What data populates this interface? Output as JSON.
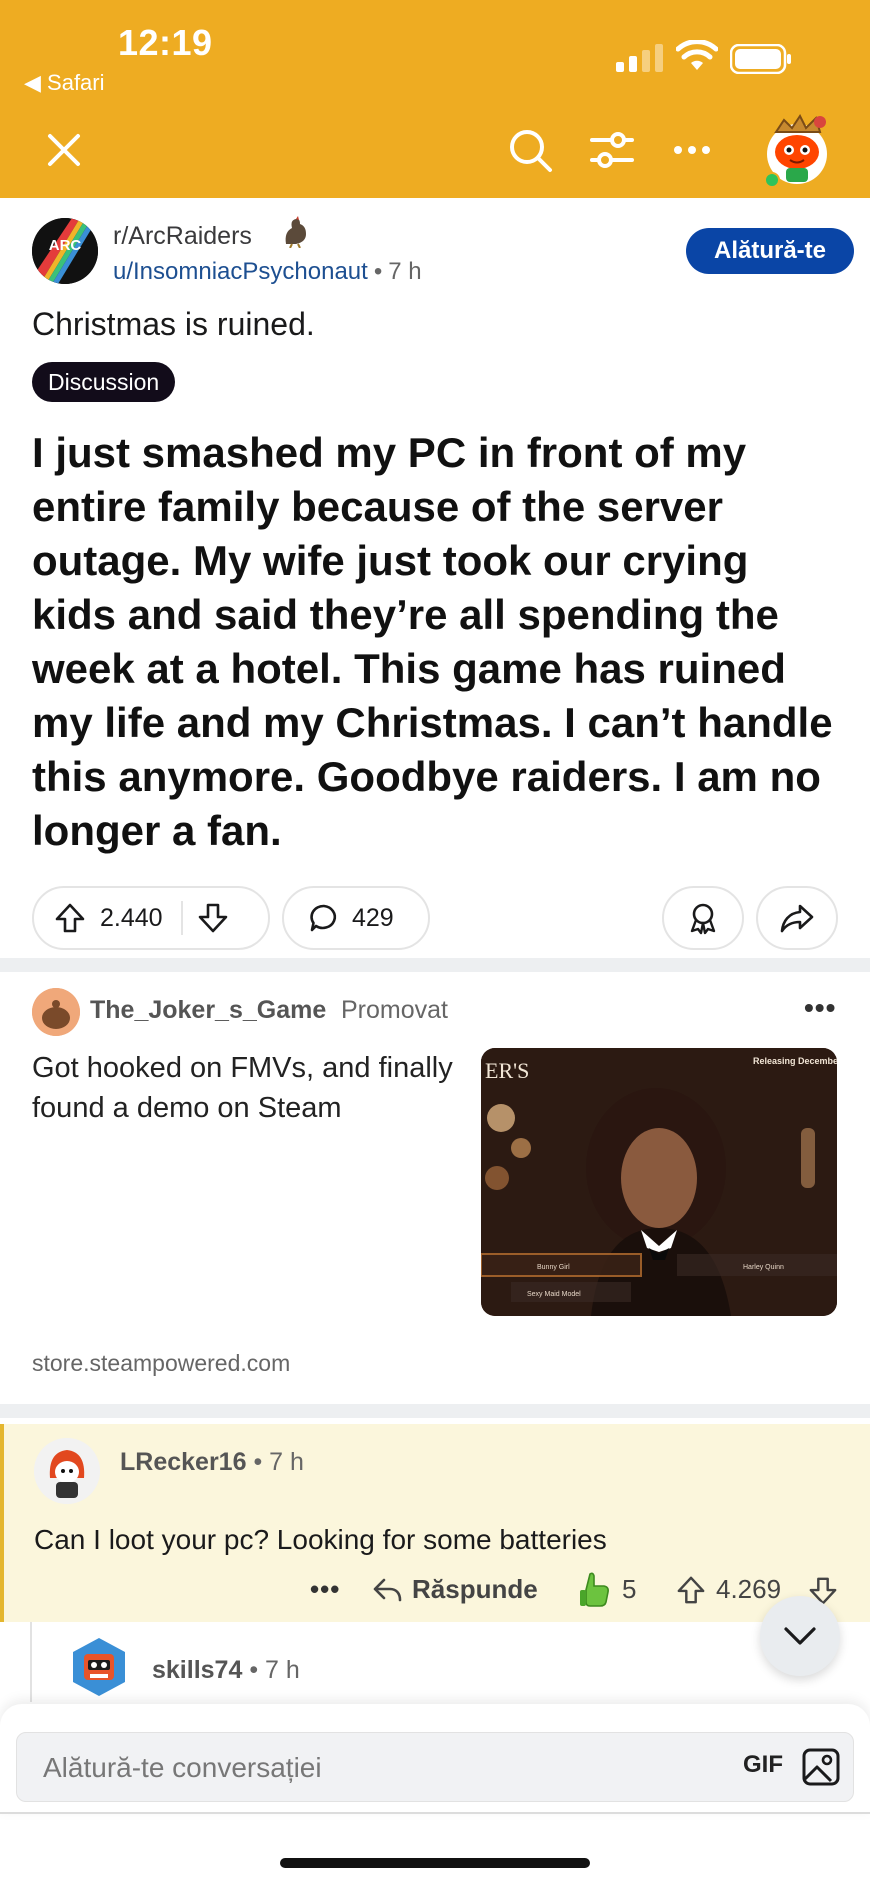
{
  "status_bar": {
    "time": "12:19",
    "back_app": "◀ Safari"
  },
  "post": {
    "subreddit": "r/ArcRaiders",
    "subreddit_logo_text": "ARC Raiders",
    "author": "u/InsomniacPsychonaut",
    "separator": "•",
    "time_ago": "7 h",
    "join_label": "Alătură-te",
    "title": "Christmas is ruined.",
    "flair": "Discussion",
    "body": "I just smashed my PC in front of my entire family because of the server outage. My wife just took our crying kids and said they’re all spending the week at a hotel. This game has ruined my life and my Christmas. I can’t handle this anymore. Goodbye raiders. I am no longer a fan.",
    "upvotes": "2.440",
    "comments": "429"
  },
  "ad": {
    "author": "The_Joker_s_Game",
    "promo_label": "Promovat",
    "more": "•••",
    "text": "Got hooked on FMVs, and finally found a demo on Steam",
    "domain": "store.steampowered.com",
    "image_texts": {
      "title_fragment": "ER'S",
      "top_right": "Releasing December",
      "option1": "Bunny Girl",
      "option2": "Harley Quinn",
      "option3": "Sexy Maid Model"
    }
  },
  "comment": {
    "author": "LRecker16",
    "separator": "•",
    "time_ago": "7 h",
    "text": "Can I loot your pc? Looking for some batteries",
    "more": "•••",
    "reply_label": "Răspunde",
    "award_count": "5",
    "votes": "4.269"
  },
  "reply": {
    "author": "skills74",
    "separator": "•",
    "time_ago": "7 h"
  },
  "composer": {
    "placeholder": "Alătură-te conversației",
    "gif_label": "GIF"
  },
  "colors": {
    "brand_bar": "#eeac22",
    "join_button": "#0a45a6",
    "highlight_comment": "#fbf6dc"
  }
}
